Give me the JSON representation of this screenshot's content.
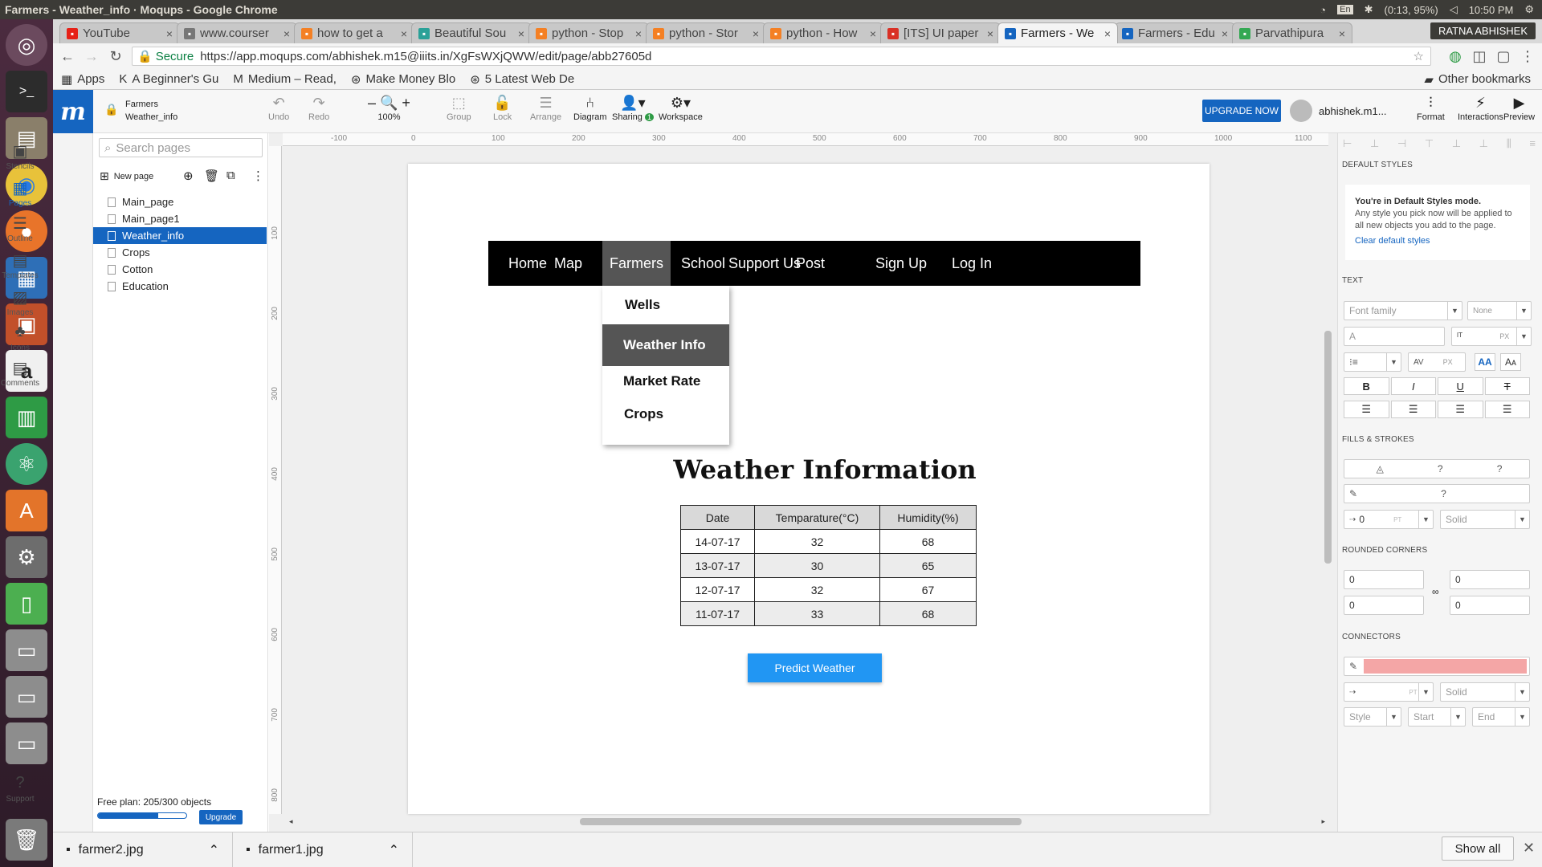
{
  "os": {
    "window_title": "Farmers - Weather_info · Moqups - Google Chrome",
    "lang": "En",
    "battery": "(0:13, 95%)",
    "time": "10:50 PM"
  },
  "tabs": [
    {
      "label": "YouTube",
      "color": "#e62117"
    },
    {
      "label": "www.courser",
      "color": "#777"
    },
    {
      "label": "how to get a",
      "color": "#f48024"
    },
    {
      "label": "Beautiful Sou",
      "color": "#2aa198"
    },
    {
      "label": "python - Stop",
      "color": "#f48024"
    },
    {
      "label": "python - Stor",
      "color": "#f48024"
    },
    {
      "label": "python - How",
      "color": "#f48024"
    },
    {
      "label": "[ITS] UI paper",
      "color": "#d93025"
    },
    {
      "label": "Farmers - We",
      "color": "#1565c0"
    },
    {
      "label": "Farmers - Edu",
      "color": "#1565c0"
    },
    {
      "label": "Parvathipura",
      "color": "#34a853"
    }
  ],
  "tab_user": "RATNA ABHISHEK",
  "omnibox": {
    "secure": "Secure",
    "url": "https://app.moqups.com/abhishek.m15@iiits.in/XgFsWXjQWW/edit/page/abb27605d"
  },
  "bookmarks": [
    "Apps",
    "A Beginner's Gu",
    "Medium – Read, ",
    "Make Money Blo",
    "5 Latest Web De"
  ],
  "other_bookmarks": "Other bookmarks",
  "project": {
    "name": "Farmers",
    "page": "Weather_info"
  },
  "toolbar": {
    "undo": "Undo",
    "redo": "Redo",
    "zoom": "100%",
    "group": "Group",
    "lock": "Lock",
    "arrange": "Arrange",
    "diagram": "Diagram",
    "sharing": "Sharing",
    "sharing_count": "1",
    "workspace": "Workspace",
    "upgrade": "UPGRADE NOW",
    "user": "abhishek.m1...",
    "format": "Format",
    "interactions": "Interactions",
    "preview": "Preview"
  },
  "rail": [
    "Stencils",
    "Pages",
    "Outline",
    "Templates",
    "Images",
    "Icons",
    "Comments",
    "Support"
  ],
  "pages_panel": {
    "search_placeholder": "Search pages",
    "new_page": "New page",
    "pages": [
      "Main_page",
      "Main_page1",
      "Weather_info",
      "Crops",
      "Cotton",
      "Education"
    ],
    "selected": "Weather_info",
    "plan": "Free plan: 205/300 objects",
    "plan_fraction": 0.68,
    "upgrade": "Upgrade"
  },
  "rulers": {
    "h": [
      "-100",
      "0",
      "100",
      "200",
      "300",
      "400",
      "500",
      "600",
      "700",
      "800",
      "900",
      "1000",
      "1100"
    ],
    "v": [
      "100",
      "200",
      "300",
      "400",
      "500",
      "600",
      "700",
      "800"
    ]
  },
  "mockup": {
    "nav": [
      "Home",
      "Map",
      "Farmers",
      "School",
      "Support Us",
      "Post",
      "Sign Up",
      "Log In"
    ],
    "dropdown": [
      "Wells",
      "Weather Info",
      "Market Rate",
      "Crops"
    ],
    "title": "Weather Information",
    "table": {
      "headers": [
        "Date",
        "Temparature(°C)",
        "Humidity(%)"
      ],
      "rows": [
        [
          "14-07-17",
          "32",
          "68"
        ],
        [
          "13-07-17",
          "30",
          "65"
        ],
        [
          "12-07-17",
          "32",
          "67"
        ],
        [
          "11-07-17",
          "33",
          "68"
        ]
      ]
    },
    "button": "Predict Weather"
  },
  "right_panel": {
    "default_styles": "DEFAULT STYLES",
    "mode_title": "You're in Default Styles mode.",
    "mode_text": "Any style you pick now will be applied to all new objects you add to the page.",
    "clear": "Clear default styles",
    "text": "TEXT",
    "font_family": "Font family",
    "none": "None",
    "px": "PX",
    "pt": "PT",
    "fills": "FILLS & STROKES",
    "q": "?",
    "solid": "Solid",
    "zero": "0",
    "rounded": "ROUNDED CORNERS",
    "connectors": "CONNECTORS",
    "style": "Style",
    "start": "Start",
    "end": "End",
    "connector_color": "#f4a6a6"
  },
  "downloads": {
    "files": [
      "farmer2.jpg",
      "farmer1.jpg"
    ],
    "show_all": "Show all"
  }
}
